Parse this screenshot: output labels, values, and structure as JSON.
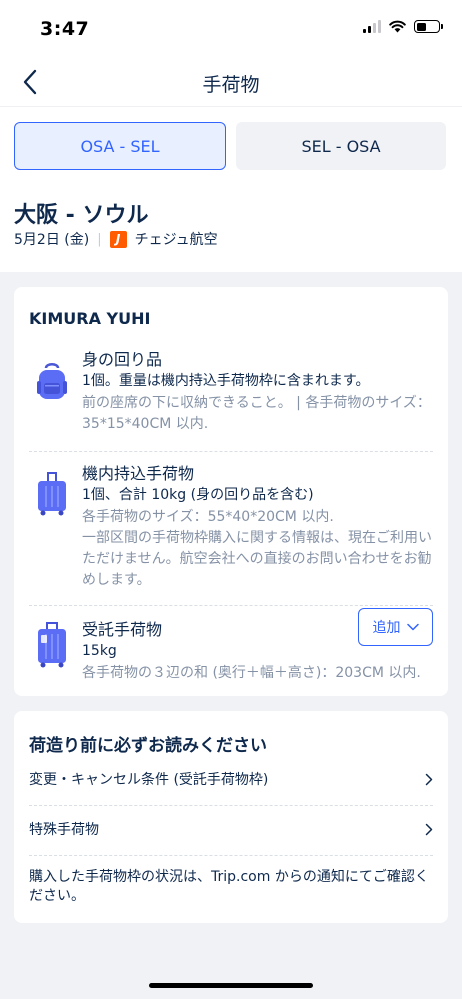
{
  "status_bar": {
    "time": "3:47"
  },
  "nav": {
    "title": "手荷物"
  },
  "route_tabs": [
    {
      "label": "OSA - SEL",
      "active": true
    },
    {
      "label": "SEL - OSA",
      "active": false
    }
  ],
  "flight": {
    "route": "大阪 - ソウル",
    "date": "5月2日 (金)",
    "separator": "|",
    "airline_logo_letter": "J",
    "airline": "チェジュ航空"
  },
  "passenger": {
    "name": "KIMURA YUHI",
    "items": [
      {
        "title": "身の回り品",
        "desc": "1個。重量は機内持込手荷物枠に含まれます。",
        "note": "前の座席の下に収納できること。 | 各手荷物のサイズ：35*15*40CM 以内."
      },
      {
        "title": "機内持込手荷物",
        "desc": "1個、合計 10kg (身の回り品を含む)",
        "note": "各手荷物のサイズ：55*40*20CM 以内.",
        "note2": "一部区間の手荷物枠購入に関する情報は、現在ご利用いただけません。航空会社への直接のお問い合わせをお勧めします。"
      },
      {
        "title": "受託手荷物",
        "desc": "15kg",
        "note": "各手荷物の３辺の和 (奥行＋幅＋高さ)：203CM 以内.",
        "add_label": "追加"
      }
    ]
  },
  "info": {
    "title": "荷造り前に必ずお読みください",
    "links": [
      {
        "label": "変更・キャンセル条件 (受託手荷物枠)"
      },
      {
        "label": "特殊手荷物"
      }
    ],
    "footer": "購入した手荷物枠の状況は、Trip.com からの通知にてご確認ください。"
  },
  "colors": {
    "accent": "#3264ff",
    "accent_bg": "#e8efff",
    "text": "#0f294d",
    "muted": "#8592a6",
    "page_bg": "#f1f2f6",
    "airline": "#ff5b00",
    "bag_blue": "#5b6cf5"
  },
  "icons": {
    "back": "chevron-left-icon",
    "personal_item": "backpack-icon",
    "carry_on": "carry-on-suitcase-icon",
    "checked": "checked-suitcase-icon",
    "add_dropdown": "chevron-down-icon",
    "link_arrow": "chevron-right-icon"
  }
}
